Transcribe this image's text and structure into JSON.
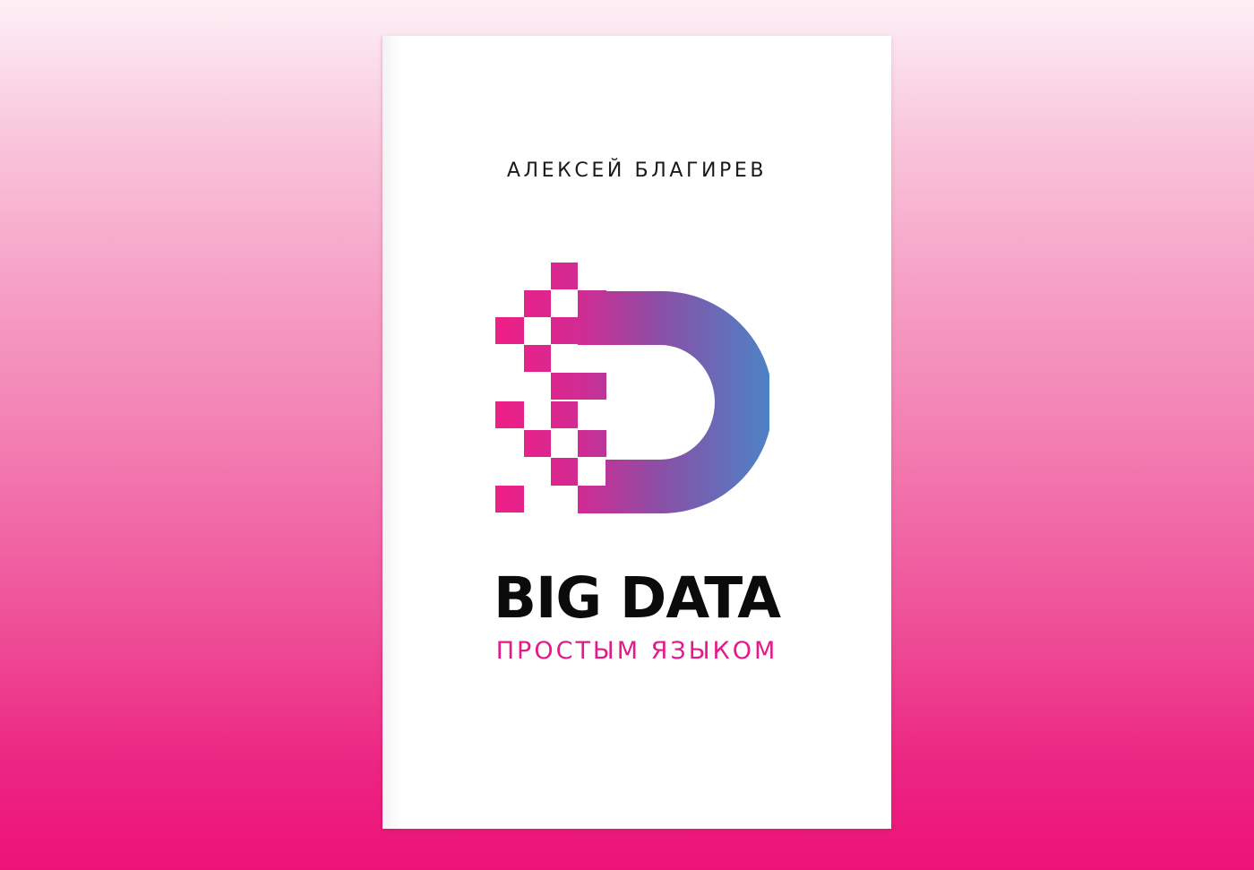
{
  "cover": {
    "author": "АЛЕКСЕЙ БЛАГИРЕВ",
    "title": "BIG DATA",
    "subtitle": "ПРОСТЫМ ЯЗЫКОМ"
  },
  "colors": {
    "background_top": "#fdf0f5",
    "background_bottom": "#ed1277",
    "accent_pink": "#e4198a",
    "logo_gradient_start": "#e91e8c",
    "logo_gradient_end": "#4f82c4",
    "title_text": "#0b0b0b"
  },
  "icons": {
    "logo": "pixelated-d-logo-icon"
  }
}
